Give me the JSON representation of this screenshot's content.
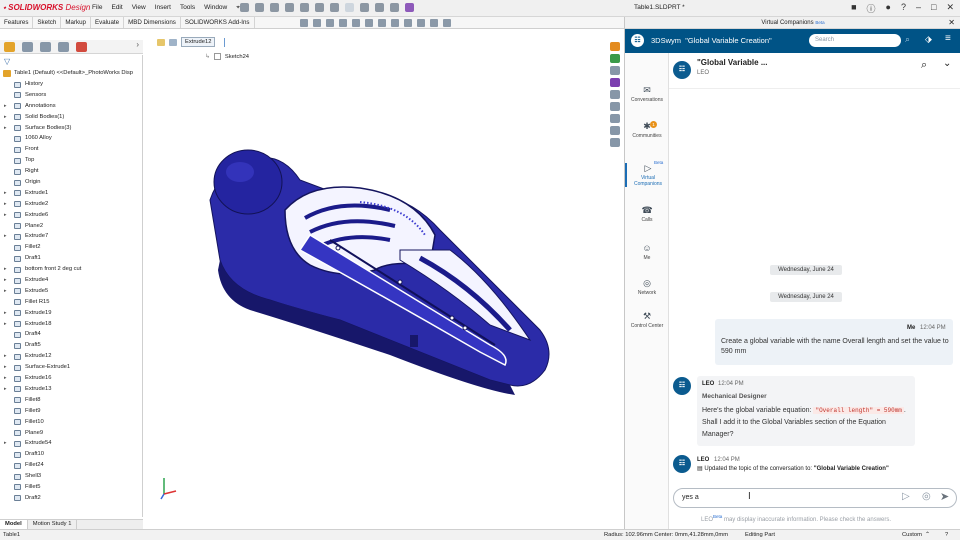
{
  "app": {
    "logo_brand": "SOLIDWORKS",
    "logo_suffix": "Design",
    "menu": [
      "File",
      "Edit",
      "View",
      "Insert",
      "Tools",
      "Window"
    ],
    "doc_title": "Table1.SLDPRT *",
    "command_tabs": [
      "Features",
      "Sketch",
      "Markup",
      "Evaluate",
      "MBD Dimensions",
      "SOLIDWORKS Add-Ins"
    ]
  },
  "tree": {
    "root": "Table1 (Default) <<Default>_PhotoWorks Disp",
    "items": [
      {
        "label": "History",
        "exp": false
      },
      {
        "label": "Sensors",
        "exp": false
      },
      {
        "label": "Annotations",
        "exp": true
      },
      {
        "label": "Solid Bodies(1)",
        "exp": true
      },
      {
        "label": "Surface Bodies(3)",
        "exp": true
      },
      {
        "label": "1060 Alloy",
        "exp": false
      },
      {
        "label": "Front",
        "exp": false
      },
      {
        "label": "Top",
        "exp": false
      },
      {
        "label": "Right",
        "exp": false
      },
      {
        "label": "Origin",
        "exp": false
      },
      {
        "label": "Extrude1",
        "exp": true
      },
      {
        "label": "Extrude2",
        "exp": true
      },
      {
        "label": "Extrude6",
        "exp": true
      },
      {
        "label": "Plane2",
        "exp": false
      },
      {
        "label": "Extrude7",
        "exp": true
      },
      {
        "label": "Fillet2",
        "exp": false
      },
      {
        "label": "Draft1",
        "exp": false
      },
      {
        "label": "bottom front 2 deg cut",
        "exp": true
      },
      {
        "label": "Extrude4",
        "exp": true
      },
      {
        "label": "Extrude5",
        "exp": true
      },
      {
        "label": "Fillet R15",
        "exp": false
      },
      {
        "label": "Extrude19",
        "exp": true
      },
      {
        "label": "Extrude18",
        "exp": true
      },
      {
        "label": "Draft4",
        "exp": false
      },
      {
        "label": "Draft5",
        "exp": false
      },
      {
        "label": "Extrude12",
        "exp": true
      },
      {
        "label": "Surface-Extrude1",
        "exp": true
      },
      {
        "label": "Extrude16",
        "exp": true
      },
      {
        "label": "Extrude13",
        "exp": true
      },
      {
        "label": "Fillet8",
        "exp": false
      },
      {
        "label": "Fillet9",
        "exp": false
      },
      {
        "label": "Fillet10",
        "exp": false
      },
      {
        "label": "Plane9",
        "exp": false
      },
      {
        "label": "Extrude54",
        "exp": true
      },
      {
        "label": "Draft10",
        "exp": false
      },
      {
        "label": "Fillet24",
        "exp": false
      },
      {
        "label": "Shell3",
        "exp": false
      },
      {
        "label": "Fillet5",
        "exp": false
      },
      {
        "label": "Draft2",
        "exp": false
      }
    ]
  },
  "bottom_tabs": [
    "Model",
    "Motion Study 1"
  ],
  "viewport": {
    "breadcrumb": "Extrude12",
    "sketch": "Sketch24"
  },
  "status": {
    "left": "Table1",
    "measure": "Radius: 102.96mm  Center: 0mm,41.28mm,0mm",
    "mode": "Editing Part",
    "units": "Custom"
  },
  "panel": {
    "header": "Virtual Companions",
    "beta": "Beta",
    "app_name": "3DSwym",
    "conversation": "\"Global Variable Creation\"",
    "search_placeholder": "Search",
    "nav": [
      {
        "label": "Conversations",
        "icon": "✉"
      },
      {
        "label": "Communities",
        "icon": "✱",
        "badge": "1"
      },
      {
        "label": "Virtual Companions",
        "icon": "▷",
        "beta": "Beta"
      },
      {
        "label": "Calls",
        "icon": "☎"
      },
      {
        "label": "Me",
        "icon": "☺"
      },
      {
        "label": "Network",
        "icon": "◎"
      },
      {
        "label": "Control Center",
        "icon": "⚒"
      }
    ],
    "chat": {
      "title": "\"Global Variable ...",
      "subtitle": "LEO",
      "date1": "Wednesday, June 24",
      "date2": "Wednesday, June 24",
      "me_name": "Me",
      "me_time": "12:04 PM",
      "me_text": "Create a global variable with the name Overall length and set the value to 590 mm",
      "leo_name": "LEO",
      "leo_time": "12:04 PM",
      "leo_role": "Mechanical Designer",
      "leo_text1": "Here's the global variable equation:",
      "leo_code": "\"Overall length\" = 590mm",
      "leo_text2": ". Shall I add it to the Global Variables section of the Equation Manager?",
      "sys_name": "LEO",
      "sys_time": "12:04 PM",
      "sys_text": "Updated the topic of the conversation to:",
      "sys_topic": "\"Global Variable Creation\"",
      "input_value": "yes a",
      "disclaimer_name": "LEO",
      "disclaimer_beta": "Beta",
      "disclaimer_text": "may display inaccurate information. Please check the answers."
    }
  },
  "colors": {
    "swym_blue": "#005386",
    "model_blue": "#2a2ab0",
    "solidworks_red": "#d8102a"
  }
}
